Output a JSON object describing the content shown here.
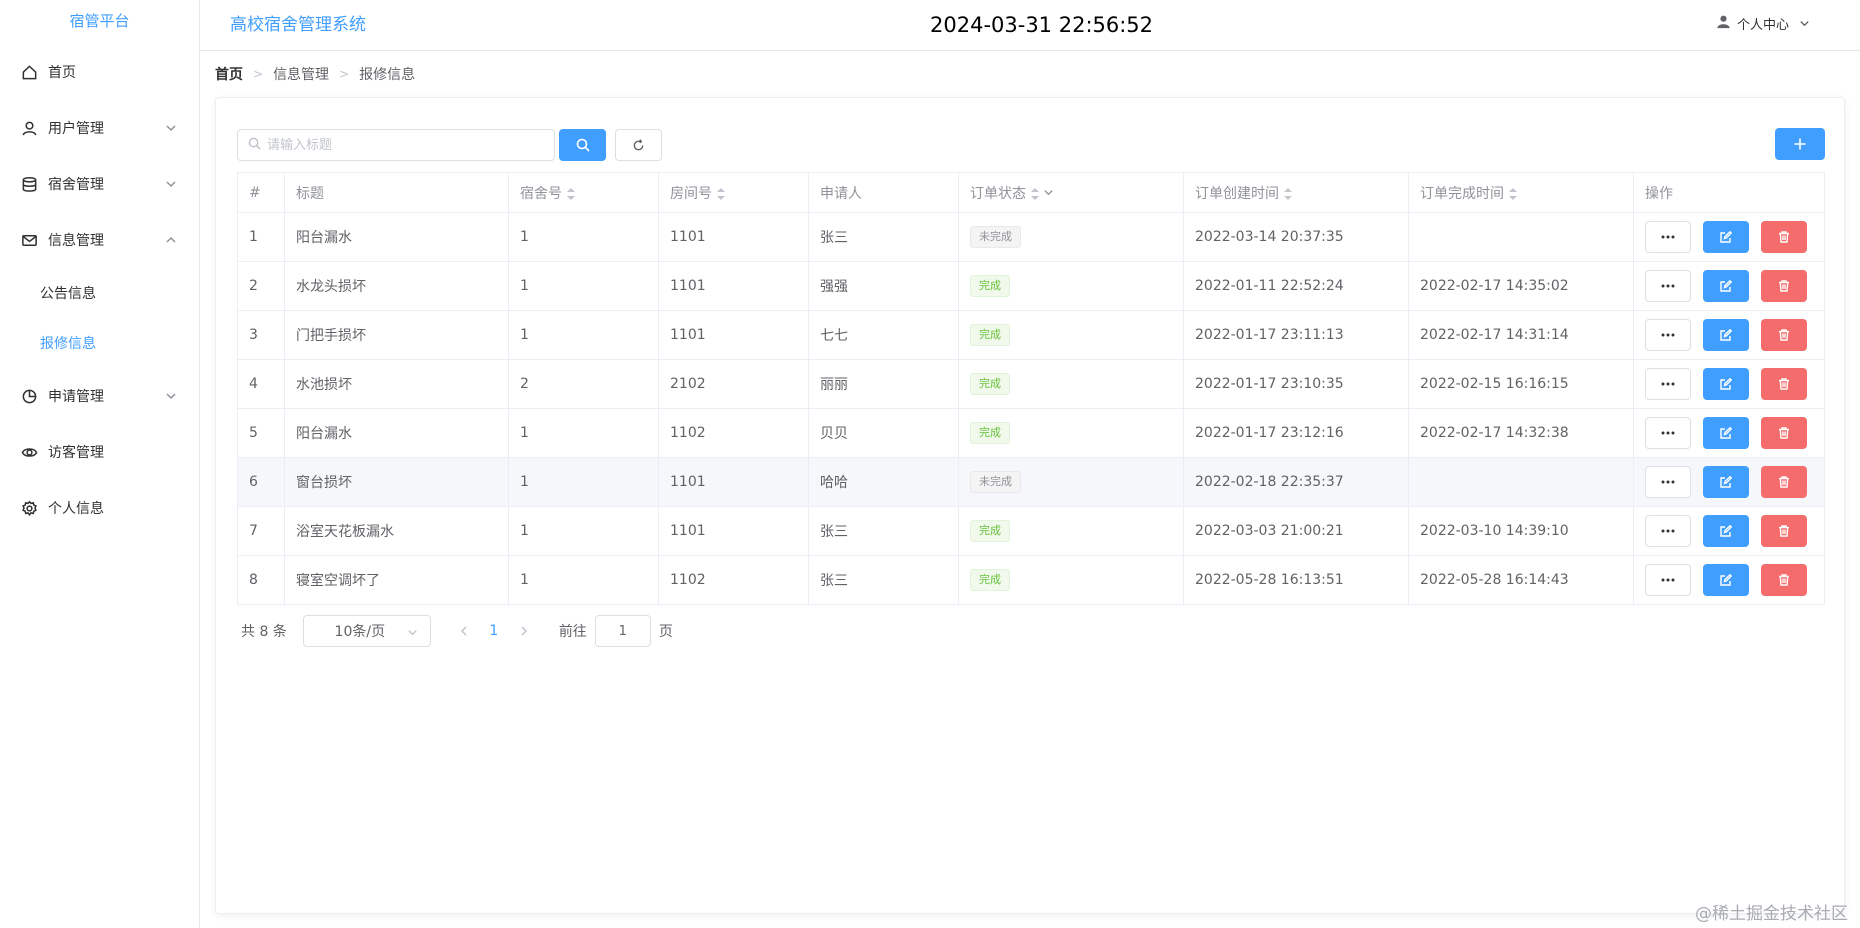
{
  "sidebar": {
    "logo": "宿管平台",
    "items": [
      {
        "label": "首页",
        "icon": "home-icon"
      },
      {
        "label": "用户管理",
        "icon": "user-icon",
        "expandable": true
      },
      {
        "label": "宿舍管理",
        "icon": "database-icon",
        "expandable": true
      },
      {
        "label": "信息管理",
        "icon": "message-icon",
        "expandable": true,
        "expanded": true
      },
      {
        "label": "申请管理",
        "icon": "pie-chart-icon",
        "expandable": true
      },
      {
        "label": "访客管理",
        "icon": "eye-icon"
      },
      {
        "label": "个人信息",
        "icon": "setting-icon"
      }
    ],
    "sub_items": [
      {
        "label": "公告信息",
        "active": false
      },
      {
        "label": "报修信息",
        "active": true
      }
    ]
  },
  "header": {
    "title": "高校宿舍管理系统",
    "clock": "2024-03-31 22:56:52",
    "user_center": "个人中心"
  },
  "breadcrumb": [
    "首页",
    "信息管理",
    "报修信息"
  ],
  "toolbar": {
    "search_placeholder": "请输入标题"
  },
  "table": {
    "columns": [
      "#",
      "标题",
      "宿舍号",
      "房间号",
      "申请人",
      "订单状态",
      "订单创建时间",
      "订单完成时间",
      "操作"
    ],
    "rows": [
      {
        "idx": "1",
        "title": "阳台漏水",
        "dorm": "1",
        "room": "1101",
        "applicant": "张三",
        "status": "未完成",
        "created": "2022-03-14 20:37:35",
        "finished": ""
      },
      {
        "idx": "2",
        "title": "水龙头损坏",
        "dorm": "1",
        "room": "1101",
        "applicant": "强强",
        "status": "完成",
        "created": "2022-01-11 22:52:24",
        "finished": "2022-02-17 14:35:02"
      },
      {
        "idx": "3",
        "title": "门把手损坏",
        "dorm": "1",
        "room": "1101",
        "applicant": "七七",
        "status": "完成",
        "created": "2022-01-17 23:11:13",
        "finished": "2022-02-17 14:31:14"
      },
      {
        "idx": "4",
        "title": "水池损坏",
        "dorm": "2",
        "room": "2102",
        "applicant": "丽丽",
        "status": "完成",
        "created": "2022-01-17 23:10:35",
        "finished": "2022-02-15 16:16:15"
      },
      {
        "idx": "5",
        "title": "阳台漏水",
        "dorm": "1",
        "room": "1102",
        "applicant": "贝贝",
        "status": "完成",
        "created": "2022-01-17 23:12:16",
        "finished": "2022-02-17 14:32:38"
      },
      {
        "idx": "6",
        "title": "窗台损坏",
        "dorm": "1",
        "room": "1101",
        "applicant": "哈哈",
        "status": "未完成",
        "created": "2022-02-18 22:35:37",
        "finished": ""
      },
      {
        "idx": "7",
        "title": "浴室天花板漏水",
        "dorm": "1",
        "room": "1101",
        "applicant": "张三",
        "status": "完成",
        "created": "2022-03-03 21:00:21",
        "finished": "2022-03-10 14:39:10"
      },
      {
        "idx": "8",
        "title": "寝室空调坏了",
        "dorm": "1",
        "room": "1102",
        "applicant": "张三",
        "status": "完成",
        "created": "2022-05-28 16:13:51",
        "finished": "2022-05-28 16:14:43"
      }
    ]
  },
  "pagination": {
    "total": "共 8 条",
    "page_size": "10条/页",
    "current_page": "1",
    "goto_label": "前往",
    "goto_value": "1",
    "page_suffix": "页"
  },
  "watermark": "@稀土掘金技术社区",
  "colors": {
    "primary": "#409eff",
    "danger": "#f56c6c",
    "success": "#67c23a",
    "info": "#909399"
  }
}
